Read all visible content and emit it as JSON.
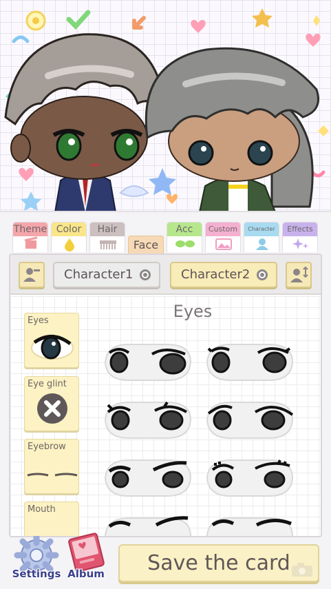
{
  "preview": {
    "characters": [
      {
        "name": "character1-sprite",
        "hair": "#a59d97",
        "skin": "#7a5a47",
        "eyes": "#2f7a32",
        "outfit": "#2e3a6e"
      },
      {
        "name": "character2-sprite",
        "hair": "#8e8e8c",
        "skin": "#c99f80",
        "eyes": "#2b4450",
        "outfit": "#3e5a38"
      }
    ]
  },
  "tabs": [
    {
      "label": "Theme",
      "color": "#f4a6aa",
      "icon": "clapper-icon"
    },
    {
      "label": "Color",
      "color": "#f9e68a",
      "icon": "paint-drop-icon"
    },
    {
      "label": "Hair",
      "color": "#ccbfc0",
      "icon": "comb-icon"
    },
    {
      "label": "Face",
      "color": "#f6d9b6",
      "icon": "",
      "active": true
    },
    {
      "label": "Acc",
      "color": "#b6e78c",
      "icon": "sunglasses-icon"
    },
    {
      "label": "Custom",
      "color": "#f4b0cf",
      "icon": "image-icon"
    },
    {
      "label": "Character",
      "color": "#a8daf0",
      "icon": "person-icon"
    },
    {
      "label": "Effects",
      "color": "#c8b2ec",
      "icon": "sparkle-icon"
    }
  ],
  "character_bar": {
    "left_icon": "character-switch-icon",
    "character1": "Character1",
    "character2": "Character2",
    "right_icon": "character-swap-icon"
  },
  "editor": {
    "section_title": "Eyes",
    "categories": [
      {
        "label": "Eyes",
        "icon": "eye-icon"
      },
      {
        "label": "Eye glint",
        "icon": "none-x-icon"
      },
      {
        "label": "Eyebrow",
        "icon": "eyebrow-icon"
      },
      {
        "label": "Mouth",
        "icon": "mouth-icon"
      }
    ],
    "eye_options_count": 8
  },
  "bottom": {
    "settings_label": "Settings",
    "album_label": "Album",
    "save_label": "Save the card"
  },
  "colors": {
    "accent_yellow": "#fbf1c6",
    "button_border": "#e2d39a",
    "label_blue": "#3a3f8c"
  }
}
